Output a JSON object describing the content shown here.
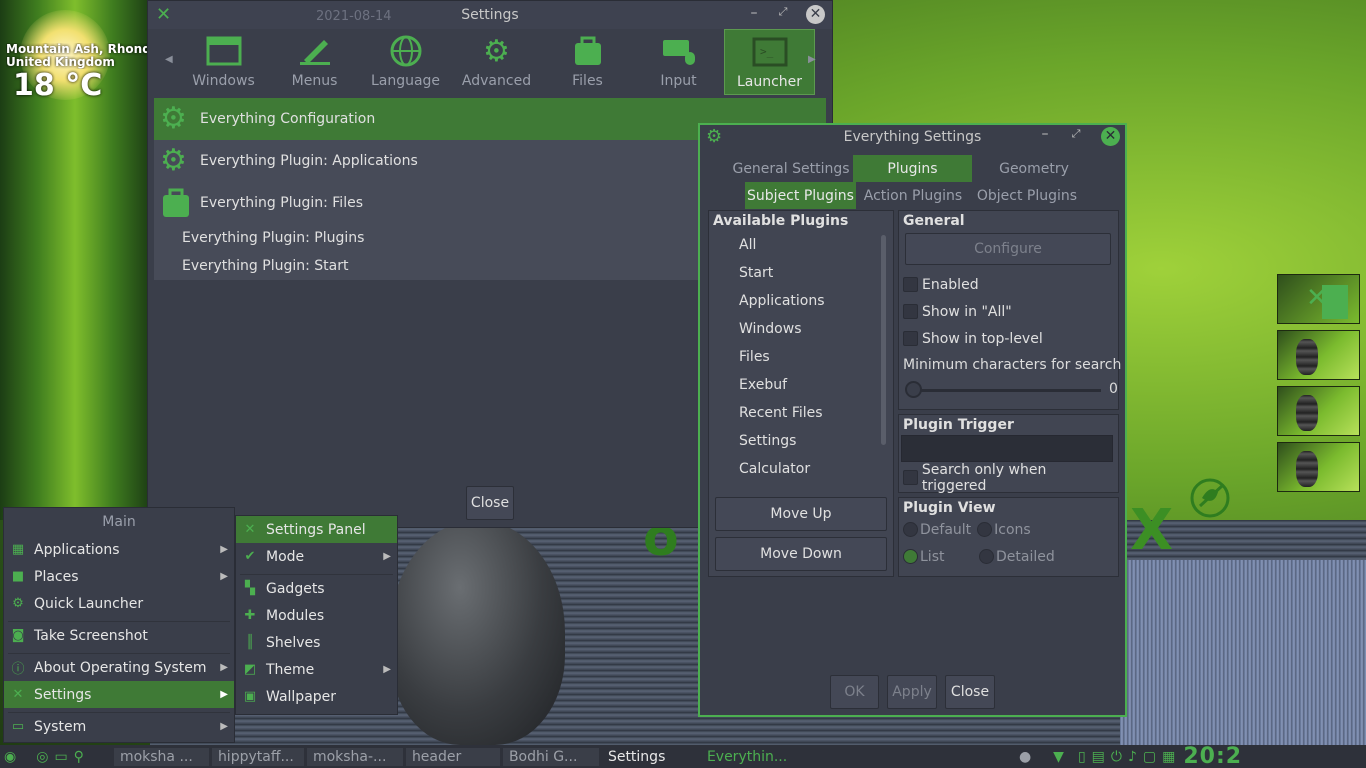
{
  "desktop": {
    "weather_location": "Mountain Ash, Rhondda",
    "weather_location2": "United Kingdom",
    "weather_temp": "18 °C"
  },
  "settings_window": {
    "title": "Settings",
    "date_overlay": "2021-08-14",
    "tools": [
      "Windows",
      "Menus",
      "Language",
      "Advanced",
      "Files",
      "Input",
      "Launcher"
    ],
    "items": [
      "Everything Configuration",
      "Everything Plugin: Applications",
      "Everything Plugin: Files",
      "Everything Plugin: Plugins",
      "Everything Plugin: Start"
    ],
    "close_label": "Close"
  },
  "everything_settings": {
    "title": "Everything Settings",
    "tabs": [
      "General Settings",
      "Plugins",
      "Geometry"
    ],
    "subtabs": [
      "Subject Plugins",
      "Action Plugins",
      "Object Plugins"
    ],
    "available_plugins_header": "Available Plugins",
    "plugins": [
      "All",
      "Start",
      "Applications",
      "Windows",
      "Files",
      "Exebuf",
      "Recent Files",
      "Settings",
      "Calculator"
    ],
    "move_up": "Move Up",
    "move_down": "Move Down",
    "general_header": "General",
    "configure": "Configure",
    "enabled": "Enabled",
    "show_in_all": "Show in \"All\"",
    "show_in_top": "Show in top-level",
    "min_chars": "Minimum characters for search",
    "min_chars_value": "0",
    "trigger_header": "Plugin Trigger",
    "search_triggered": "Search only when triggered",
    "view_header": "Plugin View",
    "view_default": "Default",
    "view_icons": "Icons",
    "view_list": "List",
    "view_detailed": "Detailed",
    "ok": "OK",
    "apply": "Apply",
    "close": "Close"
  },
  "main_menu": {
    "title": "Main",
    "items": [
      "Applications",
      "Places",
      "Quick Launcher",
      "Take Screenshot",
      "About Operating System",
      "Settings",
      "System"
    ]
  },
  "settings_submenu": {
    "items": [
      "Settings Panel",
      "Mode",
      "Gadgets",
      "Modules",
      "Shelves",
      "Theme",
      "Wallpaper"
    ]
  },
  "taskbar": {
    "tasks": [
      "moksha ...",
      "hippytaff...",
      "moksha-...",
      "header",
      "Bodhi G...",
      "Settings",
      "Everythin..."
    ],
    "clock": "20:2"
  },
  "colors": {
    "accent": "#3f7a36",
    "accent_bright": "#4caf50",
    "window_bg": "#3a3e4a"
  }
}
